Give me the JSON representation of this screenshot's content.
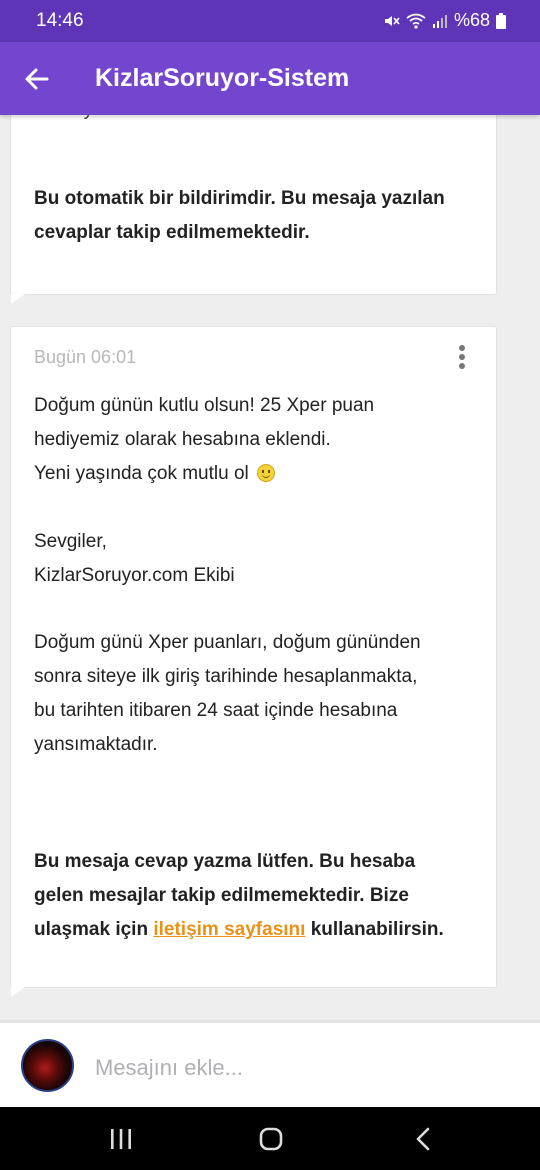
{
  "status_bar": {
    "time": "14:46",
    "battery": "%68"
  },
  "app_bar": {
    "title": "KizlarSoruyor-Sistem"
  },
  "messages": [
    {
      "partial_top": "inceleyebilirsin.",
      "footer_line1": "Bu otomatik bir bildirimdir. Bu mesaja yazılan",
      "footer_line2": "cevaplar takip edilmemektedir."
    },
    {
      "timestamp": "Bugün 06:01",
      "line1": "Doğum günün kutlu olsun! 25 Xper puan",
      "line2": "hediyemiz olarak hesabına eklendi.",
      "line3": "Yeni yaşında çok mutlu ol",
      "sign1": "Sevgiler,",
      "sign2": "KizlarSoruyor.com Ekibi",
      "info1": "Doğum günü Xper puanları, doğum gününden",
      "info2": "sonra siteye ilk giriş tarihinde hesaplanmakta,",
      "info3": "bu tarihten itibaren 24 saat içinde hesabına",
      "info4": "yansımaktadır.",
      "footer1": "Bu mesaja cevap yazma lütfen. Bu hesaba",
      "footer2": "gelen mesajlar takip edilmemektedir. Bize",
      "footer3_pre": "ulaşmak için ",
      "footer3_link": "iletişim sayfasını",
      "footer3_post": " kullanabilirsin."
    }
  ],
  "composer": {
    "placeholder": "Mesajını ekle..."
  },
  "icons": {
    "back": "arrow-left-icon",
    "more": "more-vertical-icon",
    "emoji": "smiley-emoji-icon",
    "mute": "mute-icon",
    "wifi": "wifi-icon",
    "signal": "signal-icon",
    "battery": "battery-icon",
    "recents": "recents-icon",
    "home": "home-icon",
    "nav_back": "nav-back-icon"
  },
  "colors": {
    "primary": "#7446cf",
    "status_bar": "#5f35b8",
    "link": "#e8921a"
  }
}
